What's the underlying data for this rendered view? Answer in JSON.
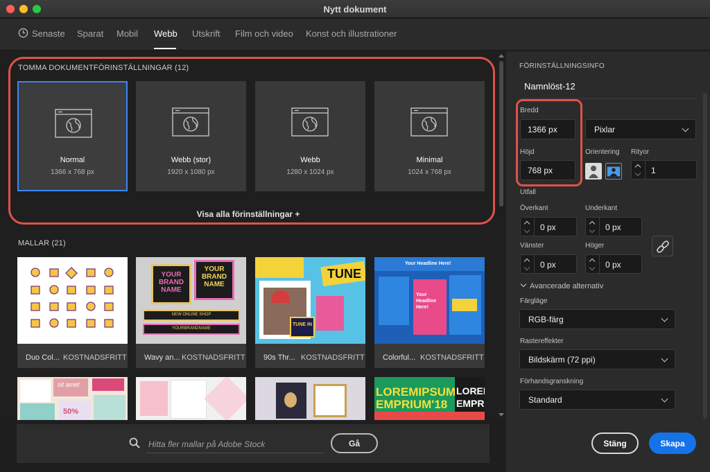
{
  "window": {
    "title": "Nytt dokument"
  },
  "tabs": [
    {
      "label": "Senaste"
    },
    {
      "label": "Sparat"
    },
    {
      "label": "Mobil"
    },
    {
      "label": "Webb"
    },
    {
      "label": "Utskrift"
    },
    {
      "label": "Film och video"
    },
    {
      "label": "Konst och illustrationer"
    }
  ],
  "active_tab": "Webb",
  "presets": {
    "title": "TOMMA DOKUMENTFÖRINSTÄLLNINGAR",
    "count": "(12)",
    "items": [
      {
        "name": "Normal",
        "size": "1366 x 768 px"
      },
      {
        "name": "Webb (stor)",
        "size": "1920 x 1080 px"
      },
      {
        "name": "Webb",
        "size": "1280 x 1024 px"
      },
      {
        "name": "Minimal",
        "size": "1024 x 768 px"
      }
    ],
    "view_all": "Visa alla förinställningar +"
  },
  "templates": {
    "title": "MALLAR",
    "count": "(21)",
    "items": [
      {
        "name": "Duo Col...",
        "badge": "KOSTNADSFRITT"
      },
      {
        "name": "Wavy an...",
        "badge": "KOSTNADSFRITT"
      },
      {
        "name": "90s Thr...",
        "badge": "KOSTNADSFRITT"
      },
      {
        "name": "Colorful...",
        "badge": "KOSTNADSFRITT"
      }
    ],
    "thumb_text": {
      "brand1": "YOUR BRAND NAME",
      "brand2": "YOUR BRAND NAME",
      "shop": "NEW ONLINE SHOP",
      "brandbar": "YOURBRANDNAME",
      "tune": "TUNE",
      "tunein": "TUNE IN",
      "headline": "Your Headline Here!",
      "lorem": "LOREMIPSUM",
      "emprium": "EMPRIUM'18",
      "lore": "LOREM",
      "empr": "EMPR",
      "sit": "sit amet",
      "fifty": "50%"
    }
  },
  "stock_search": {
    "placeholder": "Hitta fler mallar på Adobe Stock",
    "go_label": "Gå"
  },
  "preset_info": {
    "title": "FÖRINSTÄLLNINGSINFO",
    "doc_name": "Namnlöst-12",
    "width_label": "Bredd",
    "width_value": "1366 px",
    "unit": "Pixlar",
    "height_label": "Höjd",
    "height_value": "768 px",
    "orientation_label": "Orientering",
    "artboards_label": "Rityor",
    "artboards_value": "1",
    "bleed_label": "Utfall",
    "top_label": "Överkant",
    "top_value": "0 px",
    "bottom_label": "Underkant",
    "bottom_value": "0 px",
    "left_label": "Vänster",
    "left_value": "0 px",
    "right_label": "Höger",
    "right_value": "0 px",
    "advanced_label": "Avancerade alternativ",
    "color_mode_label": "Färgläge",
    "color_mode_value": "RGB-färg",
    "raster_label": "Rastereffekter",
    "raster_value": "Bildskärm (72 ppi)",
    "preview_label": "Förhandsgranskning",
    "preview_value": "Standard"
  },
  "footer": {
    "cancel_label": "Stäng",
    "create_label": "Skapa"
  },
  "colors": {
    "accent": "#1473e6",
    "highlight": "#e0524a",
    "selection": "#3b86f5"
  }
}
